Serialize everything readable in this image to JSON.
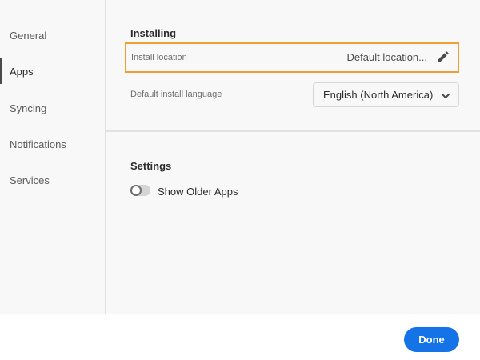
{
  "sidebar": {
    "items": [
      {
        "label": "General"
      },
      {
        "label": "Apps",
        "active": true
      },
      {
        "label": "Syncing"
      },
      {
        "label": "Notifications"
      },
      {
        "label": "Services"
      }
    ]
  },
  "installing": {
    "title": "Installing",
    "install_location_label": "Install location",
    "install_location_value": "Default location...",
    "language_label": "Default install language",
    "language_value": "English (North America)"
  },
  "settings": {
    "title": "Settings",
    "show_older_apps_label": "Show Older Apps",
    "show_older_apps_on": false
  },
  "footer": {
    "done_label": "Done"
  },
  "colors": {
    "accent": "#1473e6",
    "highlight": "#f0a031"
  }
}
